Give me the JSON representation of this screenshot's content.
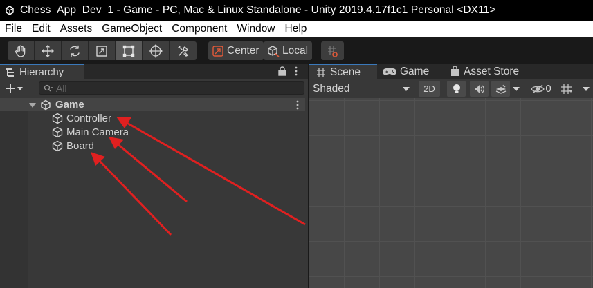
{
  "window": {
    "title": "Chess_App_Dev_1 - Game - PC, Mac & Linux Standalone - Unity 2019.4.17f1c1 Personal <DX11>"
  },
  "menubar": {
    "items": [
      "File",
      "Edit",
      "Assets",
      "GameObject",
      "Component",
      "Window",
      "Help"
    ]
  },
  "toolbar": {
    "tools": [
      "hand-icon",
      "move-icon",
      "rotate-icon",
      "scale-icon",
      "rect-transform-icon",
      "transform-icon",
      "custom-editor-tool-icon"
    ],
    "active_tool": "rect-transform-icon",
    "pivot_mode": "Center",
    "pivot_rotation": "Local"
  },
  "hierarchy": {
    "tab_label": "Hierarchy",
    "search_placeholder": "All",
    "scene_name": "Game",
    "objects": [
      "Controller",
      "Main Camera",
      "Board"
    ]
  },
  "scene_panel": {
    "tabs": [
      {
        "label": "Scene",
        "icon": "grid-hash-icon"
      },
      {
        "label": "Game",
        "icon": "gamepad-icon"
      },
      {
        "label": "Asset Store",
        "icon": "shopping-bag-icon"
      }
    ],
    "active_tab": "Scene",
    "draw_mode": "Shaded",
    "mode_2d_label": "2D",
    "hidden_count": "0"
  },
  "annotation": {
    "arrow_color": "#e02020"
  },
  "colors": {
    "accent": "#3a79bb",
    "panel": "#383838",
    "scene_bg": "#474747"
  }
}
